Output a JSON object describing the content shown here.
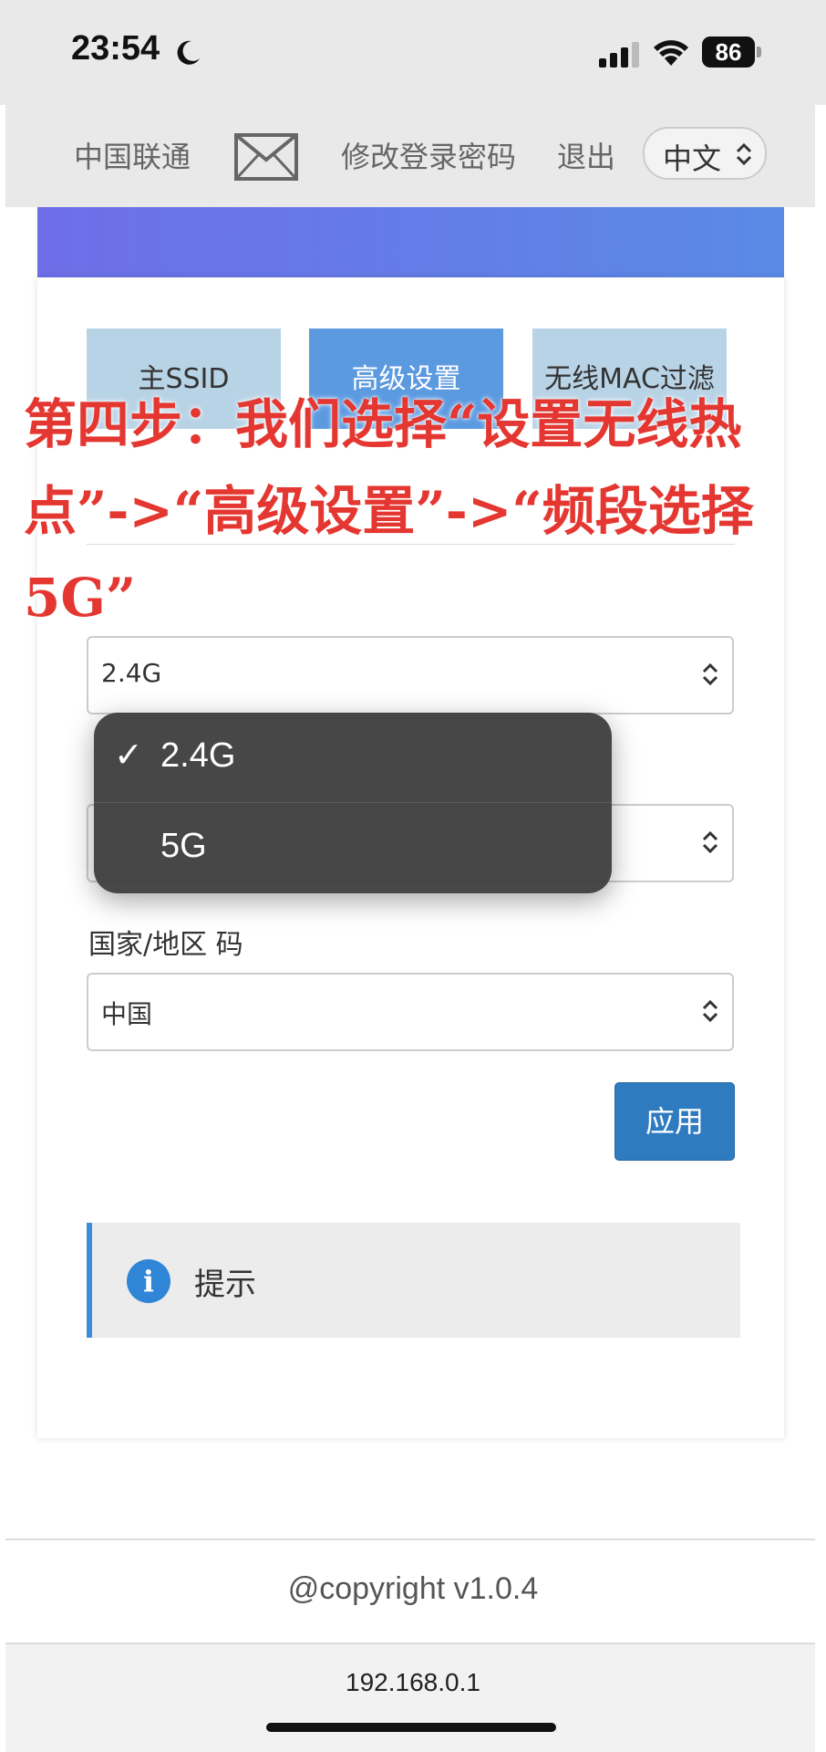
{
  "status_bar": {
    "time": "23:54",
    "battery": "86"
  },
  "nav": {
    "carrier": "中国联通",
    "change_password": "修改登录密码",
    "logout": "退出",
    "language": "中文"
  },
  "tabs": [
    {
      "label": "主SSID"
    },
    {
      "label": "高级设置"
    },
    {
      "label": "无线MAC过滤"
    }
  ],
  "form": {
    "band_value": "2.4G",
    "mode_value": "",
    "country_label": "国家/地区 码",
    "country_value": "中国",
    "apply": "应用"
  },
  "dropdown": {
    "options": [
      "2.4G",
      "5G"
    ],
    "selected": "2.4G",
    "check": "✓"
  },
  "hint": {
    "label": "提示",
    "icon_glyph": "i"
  },
  "overlay": {
    "text": "第四步：我们选择“设置无线热点”->“高级设置”->“频段选择5G”"
  },
  "footer": {
    "copyright": "@copyright  v1.0.4",
    "ip": "192.168.0.1"
  },
  "colors": {
    "accent": "#2f7bc0",
    "tab_active": "#5c9ae0",
    "tab_inactive": "#b9d3e6",
    "annotation": "#e53731"
  }
}
